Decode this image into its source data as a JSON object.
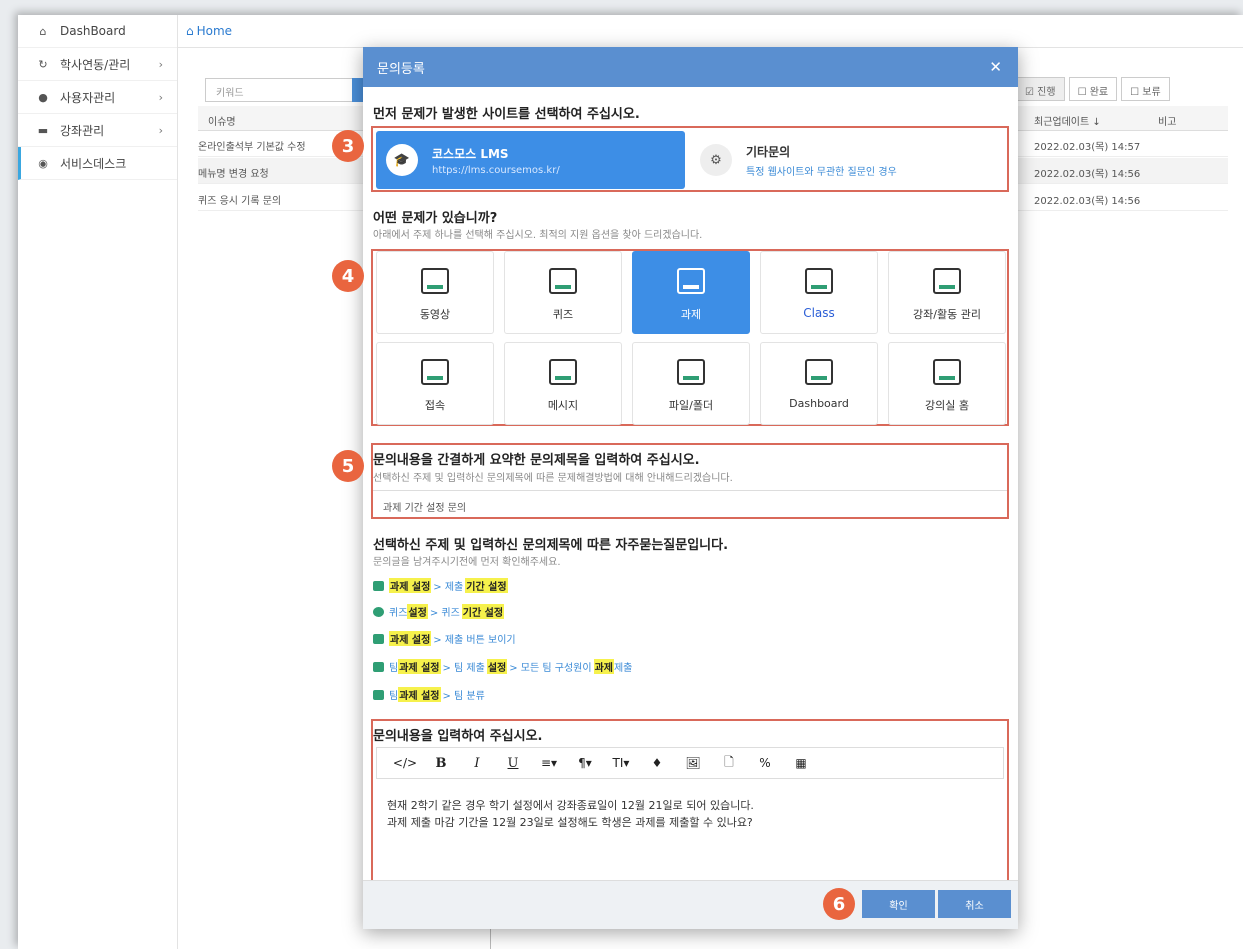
{
  "sidebar": {
    "items": [
      {
        "label": "DashBoard",
        "icon": "home-icon"
      },
      {
        "label": "학사연동/관리",
        "icon": "refresh-icon",
        "chevron": "›"
      },
      {
        "label": "사용자관리",
        "icon": "user-icon",
        "chevron": "›"
      },
      {
        "label": "강좌관리",
        "icon": "card-icon",
        "chevron": "›"
      },
      {
        "label": "서비스데스크",
        "icon": "eye-icon"
      }
    ]
  },
  "breadcrumb": {
    "home": "Home"
  },
  "background": {
    "search_placeholder": "키워드",
    "headers": {
      "issue": "이슈명",
      "updated": "최근업데이트 ↓",
      "note": "비고"
    },
    "rows": [
      {
        "issue": "온라인출석부 기본값 수정",
        "updated": "2022.02.03(목) 14:57"
      },
      {
        "issue": "메뉴명 변경 요청",
        "updated": "2022.02.03(목) 14:56"
      },
      {
        "issue": "퀴즈 응시 기록 문의",
        "updated": "2022.02.03(목) 14:56"
      }
    ],
    "filters": [
      "진행",
      "완료",
      "보류"
    ]
  },
  "modal": {
    "title": "문의등록",
    "site_question": "먼저 문제가 발생한 사이트를 선택하여 주십시오.",
    "sites": [
      {
        "name": "코스모스 LMS",
        "url": "https://lms.coursemos.kr/"
      },
      {
        "name": "기타문의",
        "desc": "특정 웹사이트와 무관한 질문인 경우"
      }
    ],
    "problem_title": "어떤 문제가 있습니까?",
    "problem_sub": "아래에서 주제 하나를 선택해 주십시오. 최적의 지원 옵션을 찾아 드리겠습니다.",
    "topics": [
      "동영상",
      "퀴즈",
      "과제",
      "Class",
      "강좌/활동 관리",
      "접속",
      "메시지",
      "파일/폴더",
      "Dashboard",
      "강의실 홈"
    ],
    "selected_topic": "과제",
    "summary_title": "문의내용을 간결하게 요약한 문의제목을 입력하여 주십시오.",
    "summary_sub": "선택하신 주제 및 입력하신 문의제목에 따른 문제해결방법에 대해 안내해드리겠습니다.",
    "summary_value": "과제 기간 설정 문의",
    "faq_title": "선택하신 주제 및 입력하신 문의제목에 따른 자주묻는질문입니다.",
    "faq_sub": "문의글을 남겨주시기전에 먼저 확인해주세요.",
    "faq": [
      {
        "a": "과제 설정",
        "b": " > 제출 ",
        "c": "기간 설정"
      },
      {
        "a": "퀴즈 ",
        "b": "설정",
        "c": " > 퀴즈 ",
        "d": "기간 설정"
      },
      {
        "a": "과제 설정",
        "b": " > 제출 버튼 보이기"
      },
      {
        "a": "팀 ",
        "b": "과제 설정",
        "c": " > 팀 제출 ",
        "d": "설정",
        "e": " > 모든 팀 구성원이 ",
        "f": "과제",
        "g": " 제출"
      },
      {
        "a": "팀 ",
        "b": "과제 설정",
        "c": " > 팀 분류"
      }
    ],
    "content_title": "문의내용을 입력하여 주십시오.",
    "toolbar": [
      "</>",
      "B",
      "I",
      "U",
      "≡▾",
      "¶▾",
      "TI▾",
      "♦",
      "🖼",
      "🗋",
      "%",
      "▦"
    ],
    "content_lines": [
      "현재 2학기 같은 경우 학기 설정에서 강좌종료일이 12월 21일로 되어 있습니다.",
      "과제 제출 마감 기간을 12월 23일로 설정해도 학생은 과제를 제출할 수 있나요?"
    ],
    "confirm": "확인",
    "cancel": "취소"
  },
  "markers": [
    "3",
    "4",
    "5",
    "6"
  ]
}
